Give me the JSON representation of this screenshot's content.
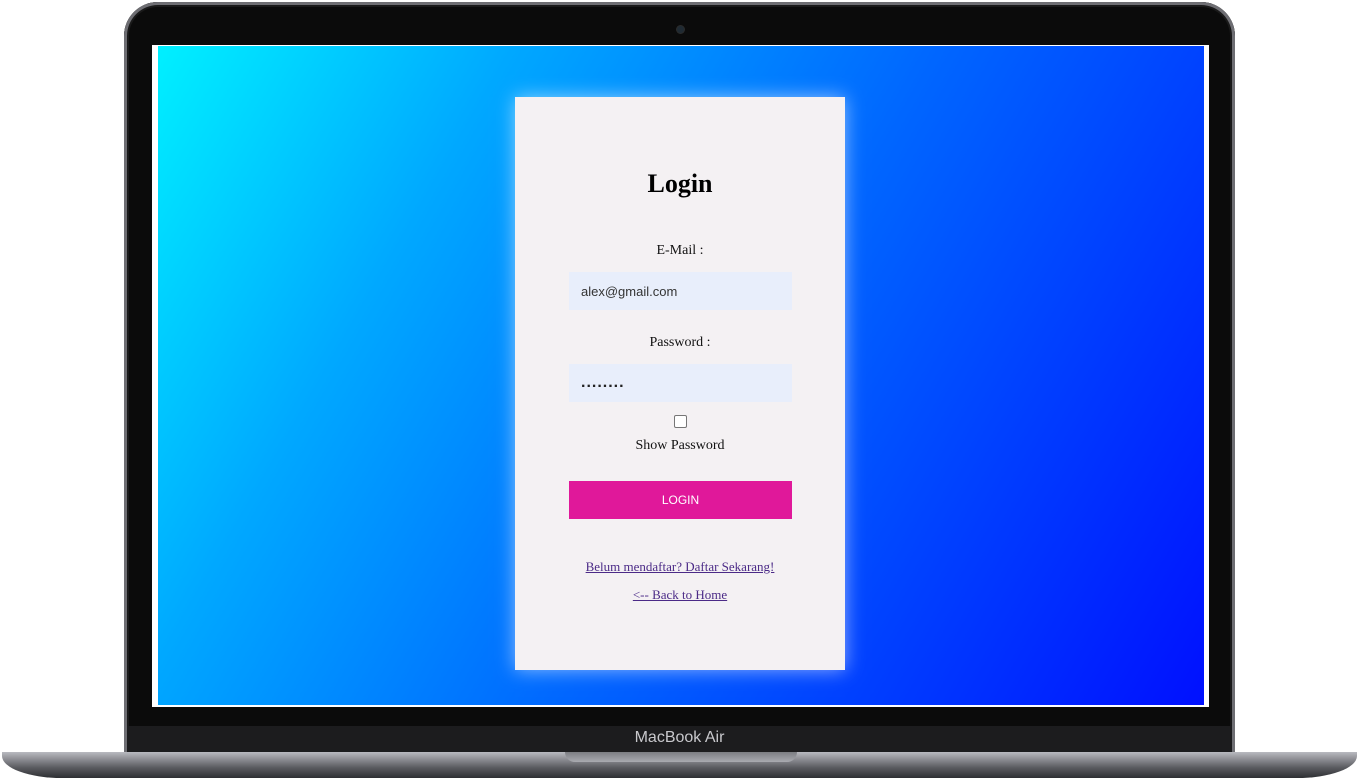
{
  "device": {
    "brand_label": "MacBook Air"
  },
  "login": {
    "title": "Login",
    "email_label": "E-Mail :",
    "email_value": "alex@gmail.com",
    "password_label": "Password :",
    "password_value": "........",
    "show_password_label": "Show Password",
    "show_password_checked": false,
    "login_button": "LOGIN",
    "register_link": "Belum mendaftar? Daftar Sekarang!",
    "back_link": "<-- Back to Home"
  },
  "colors": {
    "gradient_start": "#00f0ff",
    "gradient_end": "#0010ff",
    "card_bg": "#f4f1f3",
    "input_bg": "#e8eefb",
    "button_bg": "#e0189a",
    "link": "#4b2a87"
  }
}
